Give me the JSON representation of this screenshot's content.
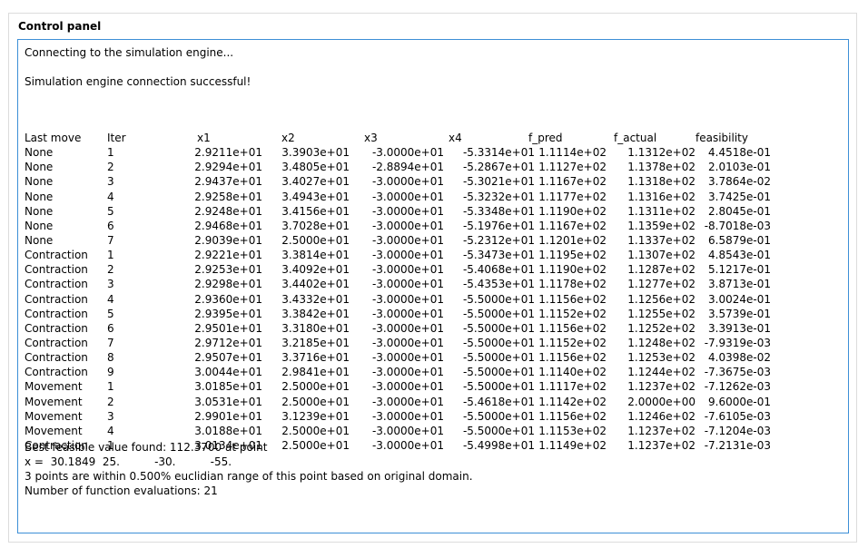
{
  "panel": {
    "title": "Control panel"
  },
  "console": {
    "line_connecting": "Connecting to the simulation engine...",
    "line_success": "Simulation engine connection successful!",
    "headers": [
      "Last move",
      "Iter",
      "x1",
      "x2",
      "x3",
      "x4",
      "f_pred",
      "f_actual",
      "feasibility"
    ],
    "rows": [
      [
        "None",
        "1",
        "2.9211e+01",
        "3.3903e+01",
        "-3.0000e+01",
        "-5.3314e+01",
        "1.1114e+02",
        "1.1312e+02",
        "4.4518e-01"
      ],
      [
        "None",
        "2",
        "2.9294e+01",
        "3.4805e+01",
        "-2.8894e+01",
        "-5.2867e+01",
        "1.1127e+02",
        "1.1378e+02",
        "2.0103e-01"
      ],
      [
        "None",
        "3",
        "2.9437e+01",
        "3.4027e+01",
        "-3.0000e+01",
        "-5.3021e+01",
        "1.1167e+02",
        "1.1318e+02",
        "3.7864e-02"
      ],
      [
        "None",
        "4",
        "2.9258e+01",
        "3.4943e+01",
        "-3.0000e+01",
        "-5.3232e+01",
        "1.1177e+02",
        "1.1316e+02",
        "3.7425e-01"
      ],
      [
        "None",
        "5",
        "2.9248e+01",
        "3.4156e+01",
        "-3.0000e+01",
        "-5.3348e+01",
        "1.1190e+02",
        "1.1311e+02",
        "2.8045e-01"
      ],
      [
        "None",
        "6",
        "2.9468e+01",
        "3.7028e+01",
        "-3.0000e+01",
        "-5.1976e+01",
        "1.1167e+02",
        "1.1359e+02",
        "-8.7018e-03"
      ],
      [
        "None",
        "7",
        "2.9039e+01",
        "2.5000e+01",
        "-3.0000e+01",
        "-5.2312e+01",
        "1.1201e+02",
        "1.1337e+02",
        "6.5879e-01"
      ],
      [
        "Contraction",
        "1",
        "2.9221e+01",
        "3.3814e+01",
        "-3.0000e+01",
        "-5.3473e+01",
        "1.1195e+02",
        "1.1307e+02",
        "4.8543e-01"
      ],
      [
        "Contraction",
        "2",
        "2.9253e+01",
        "3.4092e+01",
        "-3.0000e+01",
        "-5.4068e+01",
        "1.1190e+02",
        "1.1287e+02",
        "5.1217e-01"
      ],
      [
        "Contraction",
        "3",
        "2.9298e+01",
        "3.4402e+01",
        "-3.0000e+01",
        "-5.4353e+01",
        "1.1178e+02",
        "1.1277e+02",
        "3.8713e-01"
      ],
      [
        "Contraction",
        "4",
        "2.9360e+01",
        "3.4332e+01",
        "-3.0000e+01",
        "-5.5000e+01",
        "1.1156e+02",
        "1.1256e+02",
        "3.0024e-01"
      ],
      [
        "Contraction",
        "5",
        "2.9395e+01",
        "3.3842e+01",
        "-3.0000e+01",
        "-5.5000e+01",
        "1.1152e+02",
        "1.1255e+02",
        "3.5739e-01"
      ],
      [
        "Contraction",
        "6",
        "2.9501e+01",
        "3.3180e+01",
        "-3.0000e+01",
        "-5.5000e+01",
        "1.1156e+02",
        "1.1252e+02",
        "3.3913e-01"
      ],
      [
        "Contraction",
        "7",
        "2.9712e+01",
        "3.2185e+01",
        "-3.0000e+01",
        "-5.5000e+01",
        "1.1152e+02",
        "1.1248e+02",
        "-7.9319e-03"
      ],
      [
        "Contraction",
        "8",
        "2.9507e+01",
        "3.3716e+01",
        "-3.0000e+01",
        "-5.5000e+01",
        "1.1156e+02",
        "1.1253e+02",
        "4.0398e-02"
      ],
      [
        "Contraction",
        "9",
        "3.0044e+01",
        "2.9841e+01",
        "-3.0000e+01",
        "-5.5000e+01",
        "1.1140e+02",
        "1.1244e+02",
        "-7.3675e-03"
      ],
      [
        "Movement",
        "1",
        "3.0185e+01",
        "2.5000e+01",
        "-3.0000e+01",
        "-5.5000e+01",
        "1.1117e+02",
        "1.1237e+02",
        "-7.1262e-03"
      ],
      [
        "Movement",
        "2",
        "3.0531e+01",
        "2.5000e+01",
        "-3.0000e+01",
        "-5.4618e+01",
        "1.1142e+02",
        "2.0000e+00",
        "9.6000e-01"
      ],
      [
        "Movement",
        "3",
        "2.9901e+01",
        "3.1239e+01",
        "-3.0000e+01",
        "-5.5000e+01",
        "1.1156e+02",
        "1.1246e+02",
        "-7.6105e-03"
      ],
      [
        "Movement",
        "4",
        "3.0188e+01",
        "2.5000e+01",
        "-3.0000e+01",
        "-5.5000e+01",
        "1.1153e+02",
        "1.1237e+02",
        "-7.1204e-03"
      ],
      [
        "Contraction",
        "1",
        "3.0134e+01",
        "2.5000e+01",
        "-3.0000e+01",
        "-5.4998e+01",
        "1.1149e+02",
        "1.1237e+02",
        "-7.2131e-03"
      ]
    ],
    "best_value_line": "Best feasible value found: 112.3700 at point",
    "x_line": "x =  30.1849  25.          -30.          -55.",
    "points_line": "3 points are within 0.500% euclidian range of this point based on original domain.",
    "evals_line": "Number of function evaluations: 21"
  }
}
